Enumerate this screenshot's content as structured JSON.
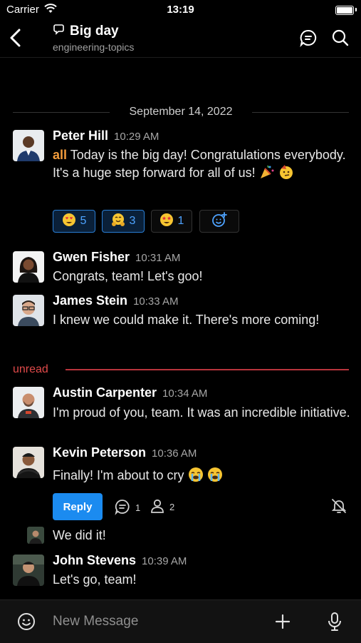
{
  "status_bar": {
    "carrier": "Carrier",
    "time": "13:19"
  },
  "header": {
    "title": "Big day",
    "subtitle": "engineering-topics"
  },
  "date_separator": "September 14, 2022",
  "posts": [
    {
      "name": "Peter Hill",
      "time": "10:29 AM",
      "mention": "all",
      "message": "Today is the big day! Congratulations everybody. It's a huge step forward for all of us!"
    },
    {
      "name": "Gwen Fisher",
      "time": "10:31 AM",
      "message": "Congrats, team! Let's goo!"
    },
    {
      "name": "James Stein",
      "time": "10:33 AM",
      "message": "I knew we could make it. There's more coming!"
    },
    {
      "name": "Austin Carpenter",
      "time": "10:34 AM",
      "message": "I'm proud of you, team. It was an incredible initiative."
    },
    {
      "name": "Kevin Peterson",
      "time": "10:36 AM",
      "message": "Finally! I'm about to cry"
    },
    {
      "message": "We did it!"
    },
    {
      "name": "John Stevens",
      "time": "10:39 AM",
      "message": "Let's go, team!"
    }
  ],
  "reactions": [
    {
      "emoji": "heart-eyes",
      "count": "5",
      "active": true
    },
    {
      "emoji": "hug",
      "count": "3",
      "active": true
    },
    {
      "emoji": "star-struck",
      "count": "1",
      "active": false
    }
  ],
  "unread_label": "unread",
  "thread": {
    "reply_label": "Reply",
    "reply_count": "1",
    "participant_count": "2"
  },
  "composer": {
    "placeholder": "New Message"
  },
  "colors": {
    "accent": "#1b8bf0",
    "unread": "#b8343c",
    "mention": "#f39c3c",
    "background": "#000000"
  }
}
